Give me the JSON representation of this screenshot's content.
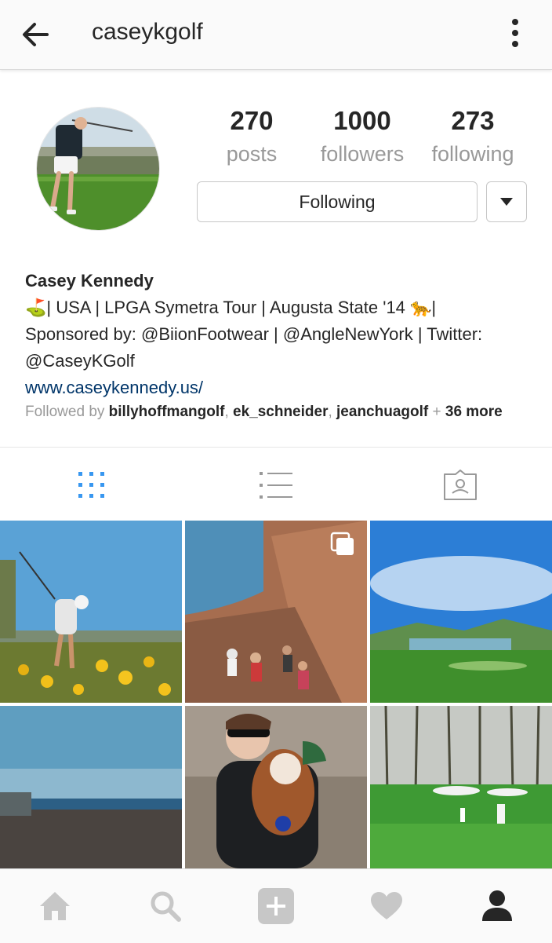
{
  "header": {
    "username": "caseykgolf"
  },
  "profile": {
    "stats": [
      {
        "value": "270",
        "label": "posts"
      },
      {
        "value": "1000",
        "label": "followers"
      },
      {
        "value": "273",
        "label": "following"
      }
    ],
    "follow_label": "Following",
    "name": "Casey Kennedy",
    "bio_line1": "⛳| USA | LPGA Symetra Tour | Augusta State '14 🐆|",
    "bio_line2": "Sponsored by:  @BiionFootwear | @AngleNewYork | Twitter:",
    "bio_line3": "@CaseyKGolf",
    "website": "www.caseykennedy.us/",
    "followed_by_prefix": "Followed by ",
    "followed_by": [
      "billyhoffmangolf",
      "ek_schneider",
      "jeanchuagolf"
    ],
    "followed_more_sep": " + ",
    "followed_more": "36 more"
  },
  "tabs": [
    "grid-view",
    "list-view",
    "tagged-view"
  ],
  "colors": {
    "accent": "#3897f0",
    "link": "#003569",
    "muted": "#999999",
    "icon_inactive": "#c7c7c7"
  },
  "grid_posts": [
    "golf swing in wildflowers",
    "canyon hiking trail",
    "golf course with lake",
    "beach at dusk",
    "woman holding spaniel dog",
    "golfers on green"
  ],
  "bottom_nav": [
    "home-icon",
    "search-icon",
    "add-icon",
    "heart-icon",
    "profile-icon"
  ]
}
